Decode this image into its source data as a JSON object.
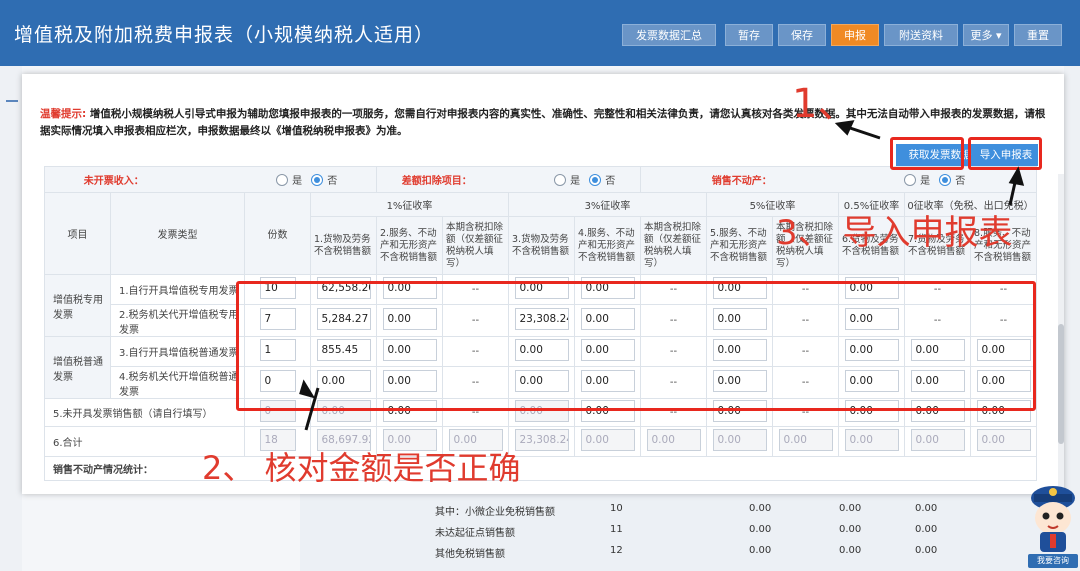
{
  "header": {
    "title": "增值税及附加税费申报表（小规模纳税人适用）",
    "buttons": {
      "invoice_summary": "发票数据汇总",
      "temp_save": "暂存",
      "save": "保存",
      "declare": "申报",
      "attachments": "附送资料",
      "more": "更多",
      "reset": "重置"
    }
  },
  "modal": {
    "tip_label": "温馨提示:",
    "tip_text": "增值税小规模纳税人引导式申报为辅助您填报申报表的一项服务，您需自行对申报表内容的真实性、准确性、完整性和相关法律负责，请您认真核对各类发票数据。其中无法自动带入申报表的发票数据，请根据实际情况填入申报表相应栏次，申报数据最终以《增值税纳税申报表》为准。",
    "get_invoice_btn": "获取发票数据",
    "import_btn": "导入申报表",
    "radio_rows": {
      "uninvoiced": "未开票收入：",
      "deduction": "差额扣除项目：",
      "real_estate": "销售不动产：",
      "yes": "是",
      "no": "否"
    },
    "headers": {
      "item": "项目",
      "invoice_type": "发票类型",
      "copies": "份数",
      "rate1": "1%征收率",
      "rate3": "3%征收率",
      "rate5": "5%征收率",
      "rate05": "0.5%征收率",
      "rate0": "0征收率（免税、出口免税）",
      "c_goods": "1.货物及劳务不含税销售额",
      "c_services": "2.服务、不动产和无形资产不含税销售额",
      "c_deduct": "本期含税扣除额（仅差额征税纳税人填写）",
      "c_goods3": "3.货物及劳务不含税销售额",
      "c_services3": "4.服务、不动产和无形资产不含税销售额",
      "c_deduct3": "本期含税扣除额（仅差额征税纳税人填写）",
      "c_services5": "5.服务、不动产和无形资产不含税销售额",
      "c_deduct5": "本期含税扣除额（仅差额征税纳税人填写）",
      "c_goods05": "6.货物及劳务不含税销售额",
      "c_goods0": "7.货物及劳务不含税销售额",
      "c_services0": "8.服务、不动产和无形资产不含税销售额"
    },
    "groups": {
      "special": "增值税专用发票",
      "general": "增值税普通发票"
    },
    "rows": [
      {
        "type": "1.自行开具增值税专用发票",
        "copies": "10",
        "goods": "62,558.20",
        "services": "0.00",
        "deduct": "--",
        "goods3": "0.00",
        "services3": "0.00",
        "deduct3": "--",
        "services5": "0.00",
        "deduct5": "--",
        "goods05": "0.00",
        "goods0": "--",
        "services0": "--"
      },
      {
        "type": "2.税务机关代开增值税专用发票",
        "copies": "7",
        "goods": "5,284.27",
        "services": "0.00",
        "deduct": "--",
        "goods3": "23,308.24",
        "services3": "0.00",
        "deduct3": "--",
        "services5": "0.00",
        "deduct5": "--",
        "goods05": "0.00",
        "goods0": "--",
        "services0": "--"
      },
      {
        "type": "3.自行开具增值税普通发票",
        "copies": "1",
        "goods": "855.45",
        "services": "0.00",
        "deduct": "--",
        "goods3": "0.00",
        "services3": "0.00",
        "deduct3": "--",
        "services5": "0.00",
        "deduct5": "--",
        "goods05": "0.00",
        "goods0": "0.00",
        "services0": "0.00"
      },
      {
        "type": "4.税务机关代开增值税普通发票",
        "copies": "0",
        "goods": "0.00",
        "services": "0.00",
        "deduct": "--",
        "goods3": "0.00",
        "services3": "0.00",
        "deduct3": "--",
        "services5": "0.00",
        "deduct5": "--",
        "goods05": "0.00",
        "goods0": "0.00",
        "services0": "0.00"
      }
    ],
    "row5": {
      "label": "5.未开具发票销售额（请自行填写）",
      "copies": "0",
      "goods": "0.00",
      "services": "0.00",
      "deduct": "--",
      "goods3": "0.00",
      "services3": "0.00",
      "deduct3": "--",
      "services5": "0.00",
      "deduct5": "--",
      "goods05": "0.00",
      "goods0": "0.00",
      "services0": "0.00"
    },
    "row6": {
      "label": "6.合计",
      "copies": "18",
      "goods": "68,697.92",
      "services": "0.00",
      "deduct": "0.00",
      "goods3": "23,308.24",
      "services3": "0.00",
      "deduct3": "0.00",
      "services5": "0.00",
      "deduct5": "0.00",
      "goods05": "0.00",
      "goods0": "0.00",
      "services0": "0.00"
    },
    "stats_label": "销售不动产情况统计："
  },
  "background_rows": [
    {
      "label": "其中：小微企业免税销售额",
      "no": "10",
      "a": "0.00",
      "b": "0.00",
      "c": "0.00"
    },
    {
      "label": "未达起征点销售额",
      "no": "11",
      "a": "0.00",
      "b": "0.00",
      "c": "0.00"
    },
    {
      "label": "其他免税销售额",
      "no": "12",
      "a": "0.00",
      "b": "0.00",
      "c": "0.00"
    }
  ],
  "annotations": {
    "step1": "1、",
    "step2": "2、 核对金额是否正确",
    "step3": "3、 导入申报表"
  },
  "mascot_label": "我要咨询",
  "colors": {
    "header_bg": "#2f6db2",
    "accent_orange": "#f08a24",
    "action_blue": "#3f8fdd",
    "annotation_red": "#e8281e"
  }
}
